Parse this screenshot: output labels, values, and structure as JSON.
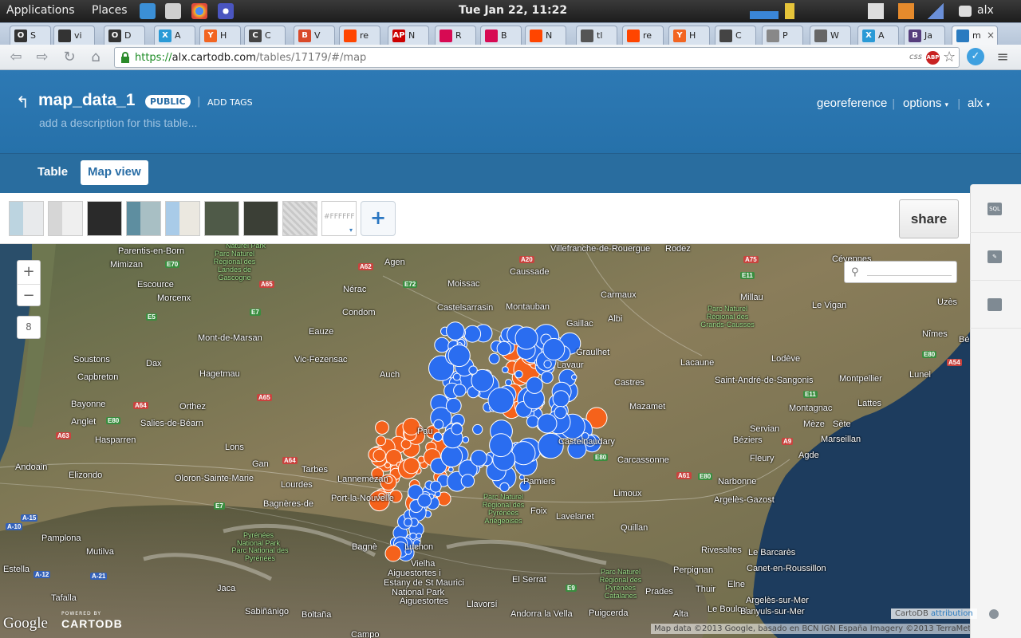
{
  "system_panel": {
    "menus": [
      "Applications",
      "Places"
    ],
    "clock": "Tue Jan 22, 11:22",
    "user": "alx"
  },
  "browser": {
    "tabs": [
      {
        "label": "S",
        "favicon": "O",
        "color": "#333333"
      },
      {
        "label": "vi",
        "favicon": "github-icon",
        "color": "#333333"
      },
      {
        "label": "D",
        "favicon": "O",
        "color": "#333333"
      },
      {
        "label": "A",
        "favicon": "X",
        "color": "#2a9ad6"
      },
      {
        "label": "H",
        "favicon": "Y",
        "color": "#f26522"
      },
      {
        "label": "C",
        "favicon": "C",
        "color": "#444444"
      },
      {
        "label": "V",
        "favicon": "B",
        "color": "#d94a2a"
      },
      {
        "label": "re",
        "favicon": "reddit-icon",
        "color": "#ff4500"
      },
      {
        "label": "N",
        "favicon": "AP",
        "color": "#cc0000"
      },
      {
        "label": "R",
        "favicon": "debian-icon",
        "color": "#d70a53"
      },
      {
        "label": "B",
        "favicon": "debian-icon",
        "color": "#d70a53"
      },
      {
        "label": "N",
        "favicon": "reddit-icon",
        "color": "#ff4500"
      },
      {
        "label": "tl",
        "favicon": "battery-icon",
        "color": "#555555"
      },
      {
        "label": "re",
        "favicon": "reddit-icon",
        "color": "#ff4500"
      },
      {
        "label": "H",
        "favicon": "Y",
        "color": "#f26522"
      },
      {
        "label": "C",
        "favicon": "avatar-icon",
        "color": "#444444"
      },
      {
        "label": "P",
        "favicon": "page-icon",
        "color": "#888888"
      },
      {
        "label": "W",
        "favicon": "hourglass-icon",
        "color": "#666666"
      },
      {
        "label": "A",
        "favicon": "X",
        "color": "#2a9ad6"
      },
      {
        "label": "Ja",
        "favicon": "B",
        "color": "#563d7c"
      },
      {
        "label": "m",
        "favicon": "cartodb-icon",
        "color": "#2a7bc0"
      }
    ],
    "url": {
      "scheme": "https://",
      "host": "alx.cartodb.com",
      "path": "/tables/17179/#/map"
    },
    "omnibox_badges": [
      "css",
      "ABP"
    ]
  },
  "app": {
    "table_name": "map_data_1",
    "privacy_badge": "PUBLIC",
    "add_tags": "ADD TAGS",
    "description_placeholder": "add a description for this table...",
    "header_links": {
      "georeference": "georeference",
      "options": "options",
      "user": "alx"
    },
    "view_tabs": {
      "table": "Table",
      "map": "Map view"
    },
    "basemap_hex": "#FFFFFF",
    "add_layer": "+",
    "share": "share",
    "side_panel": {
      "sql": "SQL"
    },
    "zoom": {
      "in": "+",
      "out": "−",
      "level": "8"
    },
    "accent": "#2d79b4"
  },
  "map": {
    "labels": [
      {
        "t": "Parentis-en-Born"
      },
      {
        "t": "Mimizan"
      },
      {
        "t": "Escource"
      },
      {
        "t": "Morcenx"
      },
      {
        "t": "Agen"
      },
      {
        "t": "Moissac"
      },
      {
        "t": "Caussade"
      },
      {
        "t": "Villefranche-de-Rouergue"
      },
      {
        "t": "Rodez"
      },
      {
        "t": "Nérac"
      },
      {
        "t": "Castelsarrasin"
      },
      {
        "t": "Montauban"
      },
      {
        "t": "Carmaux"
      },
      {
        "t": "Millau"
      },
      {
        "t": "Le Vigan"
      },
      {
        "t": "Uzès"
      },
      {
        "t": "Condom"
      },
      {
        "t": "Gaillac"
      },
      {
        "t": "Albi"
      },
      {
        "t": "Mont-de-Marsan"
      },
      {
        "t": "Eauze"
      },
      {
        "t": "Graulhet"
      },
      {
        "t": "Lavaur"
      },
      {
        "t": "Nîmes"
      },
      {
        "t": "Soustons"
      },
      {
        "t": "Dax"
      },
      {
        "t": "Vic-Fezensac"
      },
      {
        "t": "Lacaune"
      },
      {
        "t": "Lodève"
      },
      {
        "t": "Capbreton"
      },
      {
        "t": "Hagetmau"
      },
      {
        "t": "Auch"
      },
      {
        "t": "Castres"
      },
      {
        "t": "Saint-André-de-Sangonis"
      },
      {
        "t": "Montpellier"
      },
      {
        "t": "Lunel"
      },
      {
        "t": "Bayonne"
      },
      {
        "t": "Orthez"
      },
      {
        "t": "Mazamet"
      },
      {
        "t": "Lattes"
      },
      {
        "t": "Anglet"
      },
      {
        "t": "Salies-de-Béarn"
      },
      {
        "t": "Montagnac"
      },
      {
        "t": "Mèze"
      },
      {
        "t": "Sète"
      },
      {
        "t": "Hasparren"
      },
      {
        "t": "Pau"
      },
      {
        "t": "Castelnaudary"
      },
      {
        "t": "Servian"
      },
      {
        "t": "Béziers"
      },
      {
        "t": "Marseillan"
      },
      {
        "t": "Andoain"
      },
      {
        "t": "Lons"
      },
      {
        "t": "Gan"
      },
      {
        "t": "Tarbes"
      },
      {
        "t": "Carcassonne"
      },
      {
        "t": "Fleury"
      },
      {
        "t": "Agde"
      },
      {
        "t": "Elizondo"
      },
      {
        "t": "Oloron-Sainte-Marie"
      },
      {
        "t": "Lannemezan"
      },
      {
        "t": "Pamiers"
      },
      {
        "t": "Narbonne"
      },
      {
        "t": "Lourdes"
      },
      {
        "t": "Limoux"
      },
      {
        "t": "Argelès-Gazost"
      },
      {
        "t": "Bagnères-de"
      },
      {
        "t": "Port-la-Nouvelle"
      },
      {
        "t": "Foix"
      },
      {
        "t": "Lavelanet"
      },
      {
        "t": "Pamplona"
      },
      {
        "t": "Quillan"
      },
      {
        "t": "Mutilva"
      },
      {
        "t": "Rivesaltes"
      },
      {
        "t": "Le Barcarès"
      },
      {
        "t": "Bagnè"
      },
      {
        "t": "Luchon"
      },
      {
        "t": "Estella"
      },
      {
        "t": "Vielha"
      },
      {
        "t": "Perpignan"
      },
      {
        "t": "Canet-en-Roussillon"
      },
      {
        "t": "Tafalla"
      },
      {
        "t": "Aiguestortes i"
      },
      {
        "t": "Estany de St Maurici"
      },
      {
        "t": "National Park"
      },
      {
        "t": "Aiguestortes"
      },
      {
        "t": "El Serrat"
      },
      {
        "t": "Jaca"
      },
      {
        "t": "Prades"
      },
      {
        "t": "Thuir"
      },
      {
        "t": "Elne"
      },
      {
        "t": "Argelès-sur-Mer"
      },
      {
        "t": "Sabiñánigo"
      },
      {
        "t": "Boltaña"
      },
      {
        "t": "Llavorsí"
      },
      {
        "t": "Andorra la Vella"
      },
      {
        "t": "Puigcerda"
      },
      {
        "t": "Alta"
      },
      {
        "t": "Le Boulou"
      },
      {
        "t": "Banyuls-sur-Mer"
      },
      {
        "t": "Campo"
      },
      {
        "t": "Bé"
      },
      {
        "t": "Cévennes"
      }
    ],
    "parks": [
      {
        "t": "Parc Naturel Régional des Landes de Gascogne"
      },
      {
        "t": "Parc Naturel Régional des Grands-Causses"
      },
      {
        "t": "Parc Naturel Régional des Pyrénées Ariégeoises"
      },
      {
        "t": "Pyrénées National Park"
      },
      {
        "t": "Parc National des Pyrénées"
      },
      {
        "t": "Parc Naturel Régional des Pyrénées Catalanes"
      },
      {
        "t": "Naturel Park"
      }
    ],
    "road_shields": [
      {
        "t": "E70",
        "c": "green"
      },
      {
        "t": "A62",
        "c": "red"
      },
      {
        "t": "A20",
        "c": "red"
      },
      {
        "t": "A75",
        "c": "red"
      },
      {
        "t": "A65",
        "c": "red"
      },
      {
        "t": "E72",
        "c": "green"
      },
      {
        "t": "E11",
        "c": "green"
      },
      {
        "t": "E7",
        "c": "green"
      },
      {
        "t": "E5",
        "c": "green"
      },
      {
        "t": "A64",
        "c": "red"
      },
      {
        "t": "E80",
        "c": "green"
      },
      {
        "t": "A63",
        "c": "red"
      },
      {
        "t": "A65",
        "c": "red"
      },
      {
        "t": "E80",
        "c": "green"
      },
      {
        "t": "A54",
        "c": "red"
      },
      {
        "t": "A9",
        "c": "red"
      },
      {
        "t": "E11",
        "c": "green"
      },
      {
        "t": "A64",
        "c": "red"
      },
      {
        "t": "E80",
        "c": "green"
      },
      {
        "t": "A61",
        "c": "red"
      },
      {
        "t": "E80",
        "c": "green"
      },
      {
        "t": "E7",
        "c": "green"
      },
      {
        "t": "A-15",
        "c": "blue"
      },
      {
        "t": "A-10",
        "c": "blue"
      },
      {
        "t": "A-12",
        "c": "blue"
      },
      {
        "t": "A-21",
        "c": "blue"
      },
      {
        "t": "E9",
        "c": "green"
      }
    ],
    "bubble_colors": {
      "blue": "#2a6df0",
      "orange": "#f5621b"
    },
    "google_logo": "Google",
    "powered_by": "POWERED BY",
    "cartodb_logo": "CARTODB",
    "attribution": {
      "prefix": "CartoDB",
      "link": "attribution"
    },
    "map_data": "Map data ©2013 Google, basado en BCN IGN España Imagery ©2013 TerraMetrics - "
  }
}
